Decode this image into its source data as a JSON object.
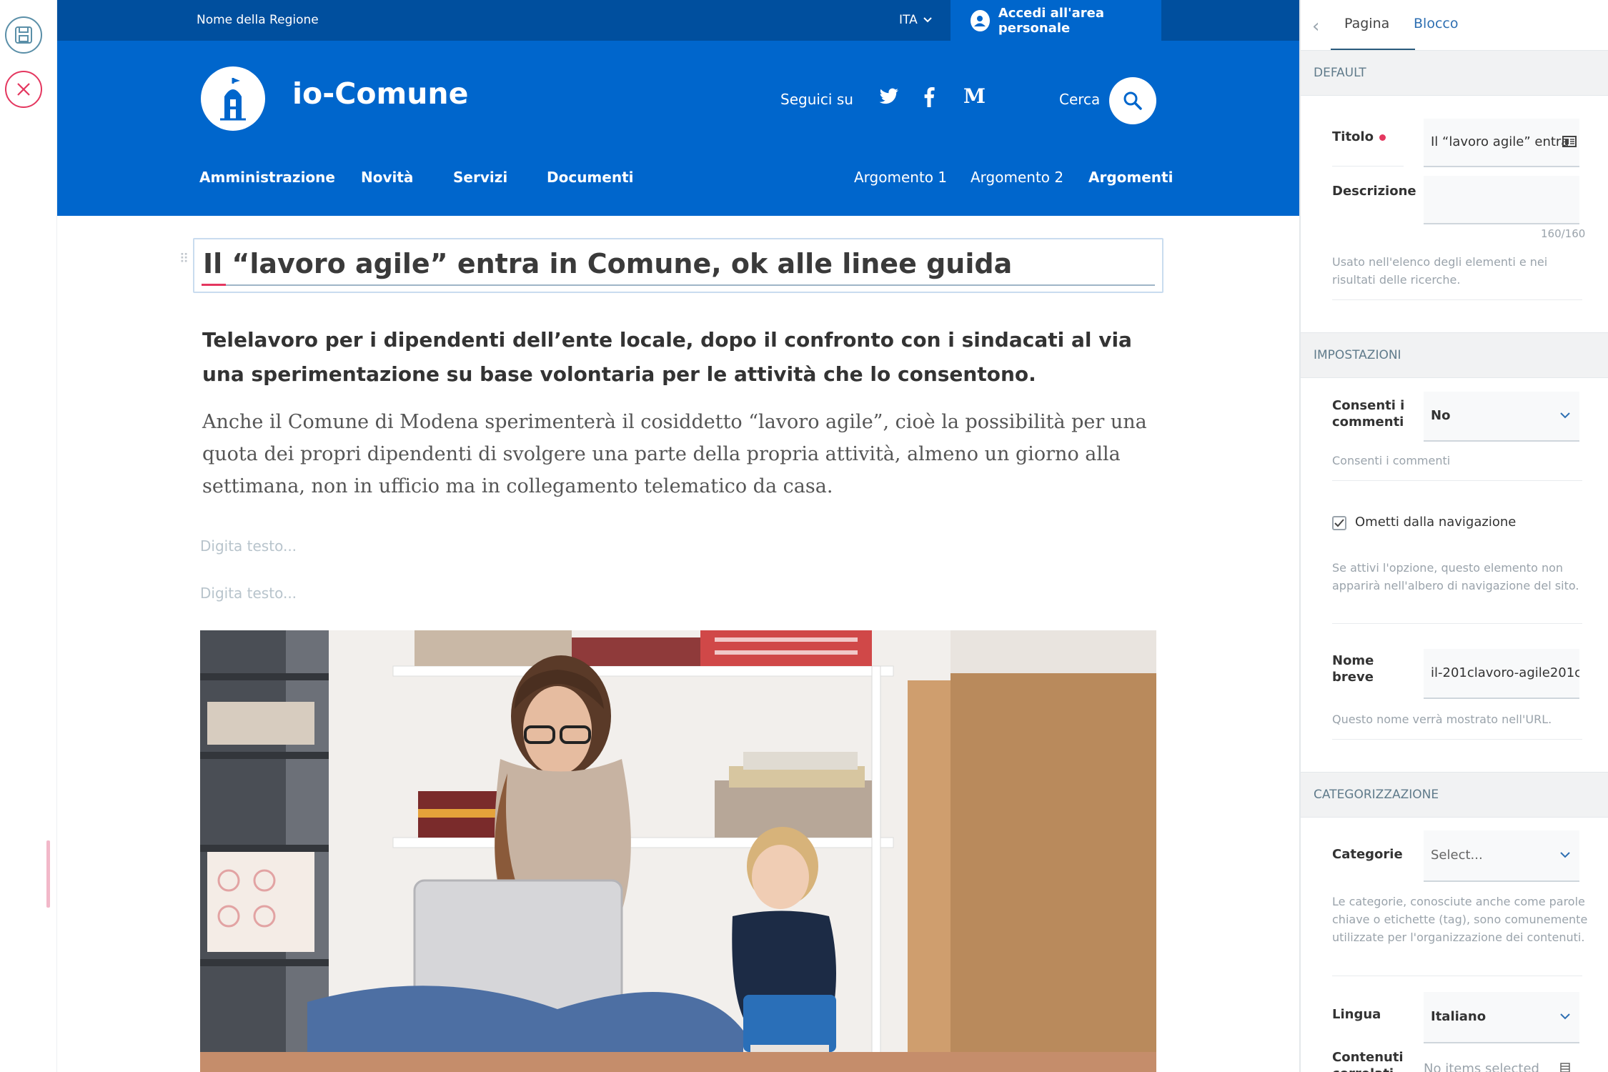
{
  "site": {
    "region_name": "Nome della Regione",
    "language": "ITA",
    "login_label": "Accedi all'area personale",
    "title": "io-Comune",
    "follow_label": "Seguici su",
    "search_label": "Cerca",
    "nav_main": [
      "Amministrazione",
      "Novità",
      "Servizi",
      "Documenti"
    ],
    "nav_topics": [
      "Argomento 1",
      "Argomento 2",
      "Argomenti"
    ]
  },
  "content": {
    "title": "Il “lavoro agile” entra in Comune, ok alle linee guida",
    "lead": "Telelavoro per i dipendenti dell’ente locale, dopo il  confronto con i sindacati al via una sperimentazione su base volontaria  per le attività che lo consentono.",
    "body": "Anche il Comune di Modena sperimenterà il cosiddetto “lavoro agile”, cioè la possibilità per una quota dei propri dipendenti di svolgere una parte della propria attività, almeno un giorno alla settimana, non in ufficio ma in collegamento telematico da casa.",
    "text_placeholders": [
      "Digita testo...",
      "Digita testo..."
    ]
  },
  "sidebar": {
    "tabs": [
      "Pagina",
      "Blocco"
    ],
    "sections": {
      "default": "DEFAULT",
      "settings": "IMPOSTAZIONI",
      "categorization": "CATEGORIZZAZIONE"
    },
    "fields": {
      "title_label": "Titolo",
      "title_value": "Il “lavoro agile” entra",
      "description_label": "Descrizione",
      "description_count": "160/160",
      "description_help": "Usato nell'elenco degli elementi e nei risultati delle ricerche.",
      "comments_label": "Consenti i commenti",
      "comments_value": "No",
      "comments_help": "Consenti i commenti",
      "exclude_nav_label": "Ometti dalla navigazione",
      "exclude_nav_help": "Se attivi l'opzione, questo elemento non apparirà nell'albero di navigazione del sito.",
      "short_name_label": "Nome breve",
      "short_name_value": "il-201clavoro-agile201c",
      "short_name_help": "Questo nome verrà mostrato nell'URL.",
      "categories_label": "Categorie",
      "categories_placeholder": "Select...",
      "categories_help": "Le categorie, conosciute anche come parole chiave o etichette (tag), sono comunemente utilizzate per l'organizzazione dei contenuti.",
      "language_label": "Lingua",
      "language_value": "Italiano",
      "related_label": "Contenuti correlati",
      "related_value": "No items selected"
    }
  },
  "colors": {
    "header_blue": "#0066cc",
    "slim_header_blue": "#004f9e",
    "accent_pink": "#e4375f",
    "tab_active": "#2e6fb2"
  }
}
